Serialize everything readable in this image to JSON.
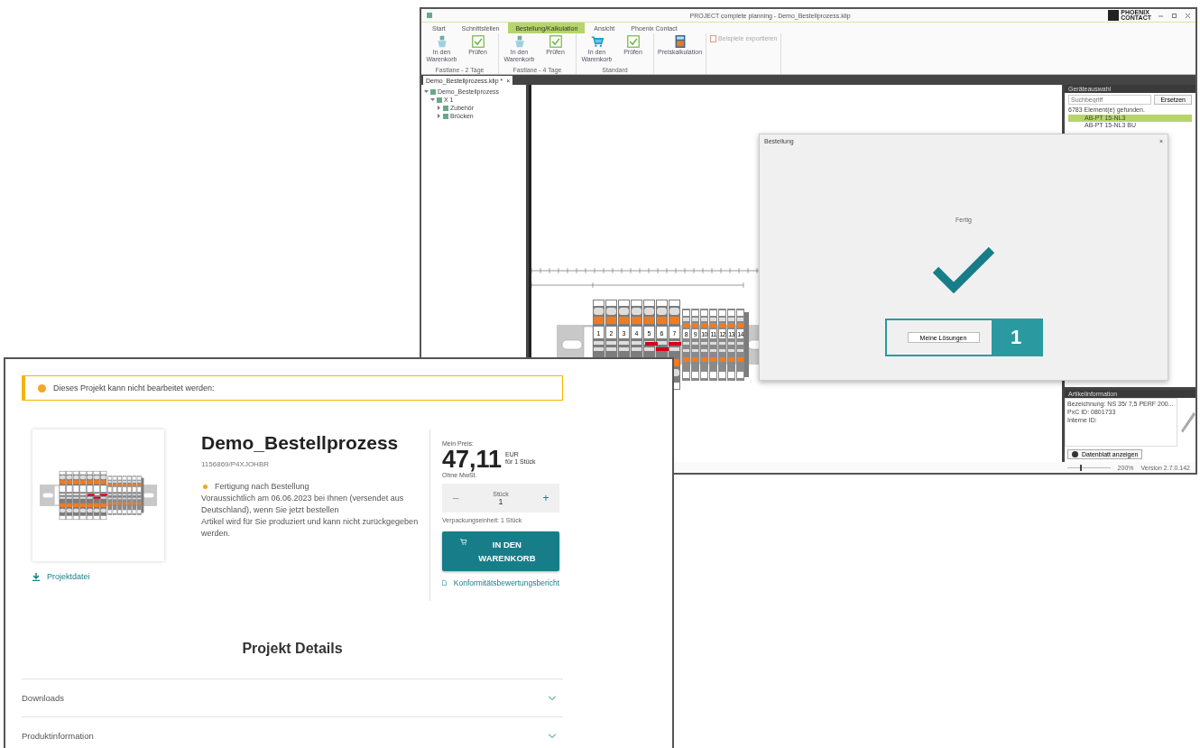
{
  "app_window": {
    "title": "PROJECT complete planning - Demo_Bestellprozess.klip",
    "logo": {
      "line_1": "PHOENIX",
      "line_2": "CONTACT"
    },
    "ribbon_tabs": [
      {
        "label": "Start",
        "selected": false
      },
      {
        "label": "Schnittstellen",
        "selected": false
      },
      {
        "label": "Bestellung/Kalkulation",
        "selected": true
      },
      {
        "label": "Ansicht",
        "selected": false
      },
      {
        "label": "Phoenix Contact",
        "selected": false
      }
    ],
    "ribbon_groups": [
      {
        "label": "Fastlane - 2 Tage",
        "buttons": [
          {
            "label": "In den Warenkorb",
            "kind": "basket"
          },
          {
            "label": "Prüfen",
            "kind": "check"
          }
        ]
      },
      {
        "label": "Fastlane - 4 Tage",
        "buttons": [
          {
            "label": "In den Warenkorb",
            "kind": "basket"
          },
          {
            "label": "Prüfen",
            "kind": "check"
          }
        ]
      },
      {
        "label": "Standard",
        "buttons": [
          {
            "label": "In den Warenkorb",
            "kind": "cart"
          },
          {
            "label": "Prüfen",
            "kind": "check"
          }
        ]
      },
      {
        "buttons": [
          {
            "label": "Preiskalkulation",
            "kind": "calculator"
          }
        ]
      },
      {
        "buttons": [
          {
            "label": "Beispiele exportieren",
            "kind": "small",
            "disabled": true
          }
        ]
      }
    ],
    "document_tab": {
      "label": "Demo_Bestellprozess.klip *",
      "close": "×"
    },
    "tree": [
      {
        "label": "Demo_Bestellprozess",
        "expanded": true,
        "children": [
          {
            "label": "X 1",
            "expanded": true,
            "children": [
              {
                "label": "Zubehör",
                "expanded": false
              },
              {
                "label": "Brücken",
                "expanded": false
              }
            ]
          }
        ]
      }
    ],
    "terminal_labels": [
      "1",
      "2",
      "3",
      "4",
      "5",
      "6",
      "7",
      "8",
      "9",
      "10",
      "11",
      "12",
      "13",
      "14"
    ],
    "device_panel": {
      "title": "Geräteauswahl",
      "search": {
        "placeholder": "Suchbegriff"
      },
      "button": "Ersetzen",
      "result": "6783 Element(e) gefunden.",
      "items": [
        {
          "label": "AB-PT 15-NL3",
          "selected": true
        },
        {
          "label": "AB-PT 15-NL3 BU",
          "selected": false
        }
      ]
    },
    "info_panel": {
      "title": "Artikelinformation",
      "lines": [
        "Bezeichnung: NS 35/ 7,5 PERF 200...",
        "PxC ID: 0801733",
        "Interne ID:"
      ],
      "button": "Datenblatt anzeigen"
    },
    "status_bar": {
      "level": 0.3,
      "zoom": "200%",
      "version": "Version 2.7.0.142"
    },
    "dialog": {
      "title": "Bestellung",
      "close": "×",
      "message": "Fertig",
      "button": "Meine Lösungen",
      "callout": "1"
    }
  },
  "web_page": {
    "alert": "Dieses Projekt kann nicht bearbeitet werden:",
    "download_link": "Projektdatei",
    "title": "Demo_Bestellprozess",
    "article_id": "1156869/P4XJOHBR",
    "status": {
      "label": "Fertigung nach Bestellung",
      "color": "#f5a623"
    },
    "delivery": "Voraussichtlich am 06.06.2023 bei Ihnen (versendet aus Deutschland), wenn Sie jetzt bestellen",
    "note": "Artikel wird für Sie produziert und kann nicht zurückgegeben werden.",
    "price": {
      "label": "Mein Preis:",
      "amount": "47,11",
      "currency": "EUR",
      "per": "für 1 Stück",
      "tax": "Ohne MwSt."
    },
    "quantity": {
      "label": "Stück",
      "minus": "–",
      "value": "1",
      "plus": "+"
    },
    "packaging": "Verpackungseinheit: 1 Stück",
    "cart_button": "IN DEN WARENKORB",
    "report_link": "Konformitätsbewertungsbericht",
    "details_title": "Projekt Details",
    "accordions": [
      {
        "label": "Downloads",
        "expanded": false
      },
      {
        "label": "Produktinformation",
        "expanded": false
      }
    ]
  }
}
